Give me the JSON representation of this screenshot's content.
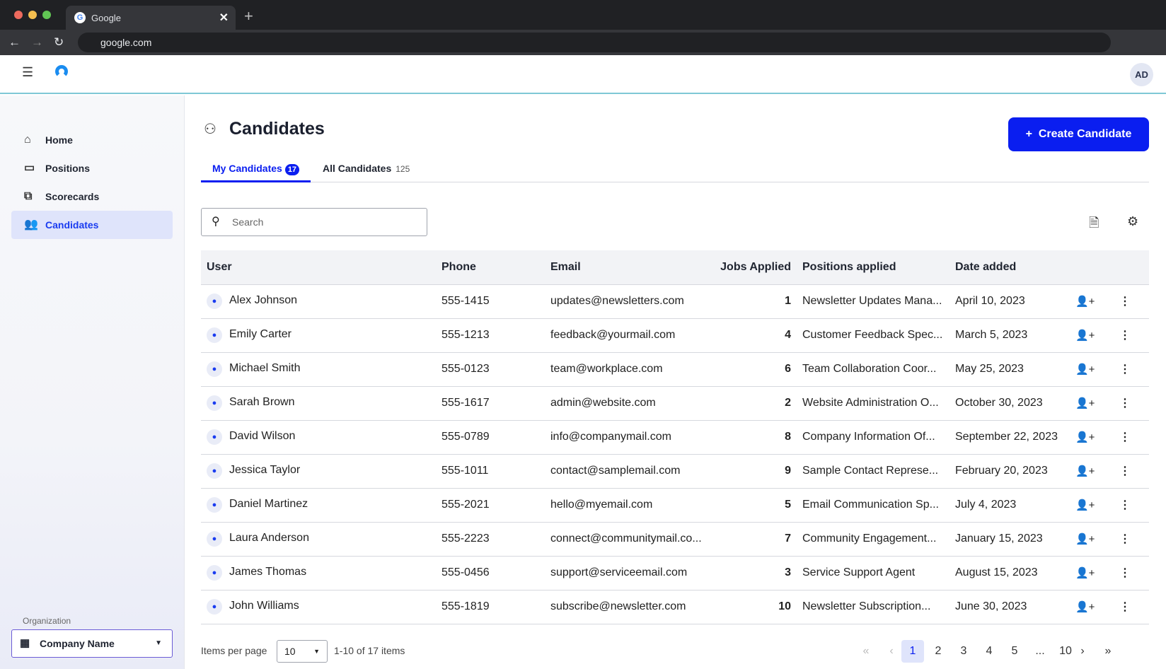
{
  "browser": {
    "tab_title": "Google",
    "url": "google.com"
  },
  "header": {
    "avatar_initials": "AD"
  },
  "sidebar": {
    "items": [
      {
        "label": "Home",
        "icon": "home-icon"
      },
      {
        "label": "Positions",
        "icon": "briefcase-icon"
      },
      {
        "label": "Scorecards",
        "icon": "scorecard-icon"
      },
      {
        "label": "Candidates",
        "icon": "people-icon",
        "active": true
      }
    ],
    "org_label": "Organization",
    "org_value": "Company Name"
  },
  "main": {
    "title": "Candidates",
    "create_label": "Create Candidate",
    "tabs": [
      {
        "label": "My Candidates",
        "count": "17"
      },
      {
        "label": "All Candidates",
        "count": "125"
      }
    ],
    "search_placeholder": "Search",
    "columns": [
      "User",
      "Phone",
      "Email",
      "Jobs Applied",
      "Positions applied",
      "Date added"
    ],
    "rows": [
      [
        "Alex Johnson",
        "555-1415",
        "updates@newsletters.com",
        "1",
        "Newsletter Updates Mana...",
        "April 10, 2023"
      ],
      [
        "Emily Carter",
        "555-1213",
        "feedback@yourmail.com",
        "4",
        "Customer Feedback Spec...",
        "March 5, 2023"
      ],
      [
        "Michael Smith",
        "555-0123",
        "team@workplace.com",
        "6",
        "Team Collaboration Coor...",
        "May 25, 2023"
      ],
      [
        "Sarah Brown",
        "555-1617",
        "admin@website.com",
        "2",
        "Website Administration O...",
        "October 30, 2023"
      ],
      [
        "David Wilson",
        "555-0789",
        "info@companymail.com",
        "8",
        "Company Information Of...",
        "September 22, 2023"
      ],
      [
        "Jessica Taylor",
        "555-1011",
        "contact@samplemail.com",
        "9",
        "Sample Contact Represe...",
        "February 20, 2023"
      ],
      [
        "Daniel Martinez",
        "555-2021",
        "hello@myemail.com",
        "5",
        "Email Communication Sp...",
        "July 4, 2023"
      ],
      [
        "Laura Anderson",
        "555-2223",
        "connect@communitymail.co...",
        "7",
        "Community Engagement...",
        "January 15, 2023"
      ],
      [
        "James Thomas",
        "555-0456",
        "support@serviceemail.com",
        "3",
        "Service Support Agent",
        "August 15, 2023"
      ],
      [
        "John Williams",
        "555-1819",
        "subscribe@newsletter.com",
        "10",
        "Newsletter Subscription...",
        "June 30, 2023"
      ]
    ],
    "footer": {
      "items_per_page_label": "Items per page",
      "per_page": "10",
      "range": "1-10 of 17 items",
      "pages": [
        "1",
        "2",
        "3",
        "4",
        "5",
        "...",
        "10"
      ]
    }
  },
  "colors": {
    "accent": "#0a1ef0"
  }
}
